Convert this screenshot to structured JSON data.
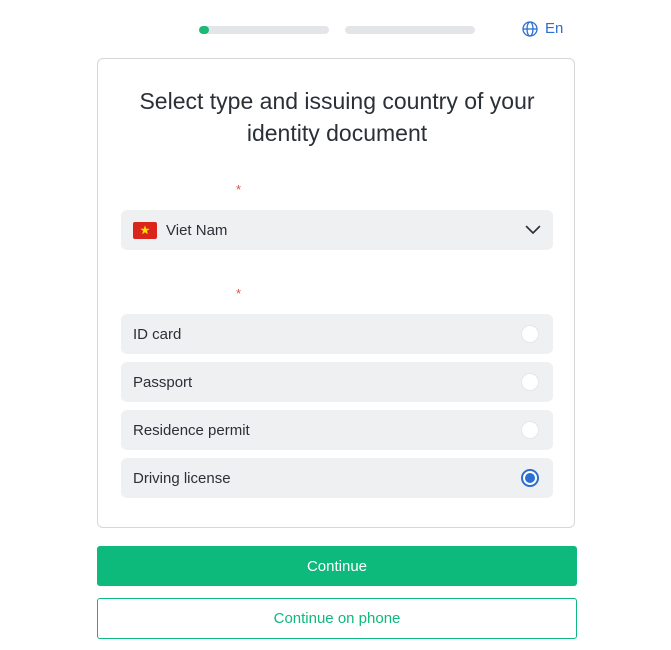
{
  "progress": {
    "steps": [
      {
        "fill_fraction": 0.08
      },
      {
        "fill_fraction": 0.0
      }
    ]
  },
  "language": {
    "label": "En",
    "icon": "globe-icon"
  },
  "card": {
    "title": "Select type and issuing country of your identity document",
    "country": {
      "required_mark": "*",
      "selected": "Viet Nam",
      "flag_icon": "vietnam-flag-icon"
    },
    "document_type": {
      "required_mark": "*",
      "options": [
        {
          "label": "ID card",
          "checked": false
        },
        {
          "label": "Passport",
          "checked": false
        },
        {
          "label": "Residence permit",
          "checked": false
        },
        {
          "label": "Driving license",
          "checked": true
        }
      ]
    }
  },
  "actions": {
    "continue_label": "Continue",
    "continue_on_phone_label": "Continue on phone"
  },
  "colors": {
    "accent_green": "#0db97b",
    "accent_blue": "#2b6fd1",
    "required_red": "#e0533d"
  }
}
